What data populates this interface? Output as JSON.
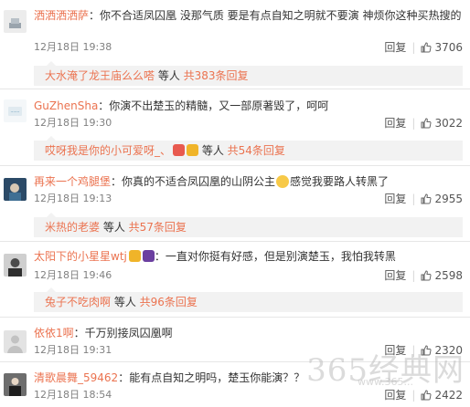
{
  "comments": [
    {
      "user": "洒洒洒洒萨",
      "text": "：你不合适凤囚凰 没那气质 要是有点自知之明就不要演 神烦你这种买热搜的",
      "time": "12月18日 19:38",
      "reply_label": "回复",
      "likes": "3706",
      "replies_summary": {
        "user": "大水淹了龙王庙么么嗒",
        "mid": " 等人 ",
        "count": "共383条回复"
      }
    },
    {
      "user": "GuZhenSha",
      "text": "：你演不出楚玉的精髓，又一部原著毁了，呵呵",
      "time": "12月18日 19:30",
      "reply_label": "回复",
      "likes": "3022",
      "replies_summary": {
        "user": "哎呀我是你的小可爱呀_、",
        "mid": " 等人 ",
        "count": "共54条回复"
      }
    },
    {
      "user": "再来一个鸡腿堡",
      "text_before": "：你真的不适合凤囚凰的山阴公主",
      "text_after": "感觉我要路人转黑了",
      "time": "12月18日 19:13",
      "reply_label": "回复",
      "likes": "2955",
      "replies_summary": {
        "user": "米热的老婆",
        "mid": " 等人 ",
        "count": "共57条回复"
      }
    },
    {
      "user": "太阳下的小星星wtj",
      "text": "：一直对你挺有好感，但是别演楚玉，我怕我转黑",
      "time": "12月18日 19:46",
      "reply_label": "回复",
      "likes": "2598",
      "replies_summary": {
        "user": "兔子不吃肉啊",
        "mid": " 等人 ",
        "count": "共96条回复"
      }
    },
    {
      "user": "依依1啊",
      "text": "：千万别接凤囚凰啊",
      "time": "12月18日 19:31",
      "reply_label": "回复",
      "likes": "2320"
    },
    {
      "user": "清歌晨舞_59462",
      "text": "：能有点自知之明吗，楚玉你能演？？",
      "time": "12月18日 18:54",
      "reply_label": "回复",
      "likes": "2422"
    }
  ],
  "watermark": {
    "main": "365经典网",
    "sub": "www.365..."
  },
  "colors": {
    "username": "#eb7350",
    "meta": "#808080",
    "reply_bg": "#f2f2f2"
  },
  "icons": {
    "like": "thumbs-up-icon"
  }
}
